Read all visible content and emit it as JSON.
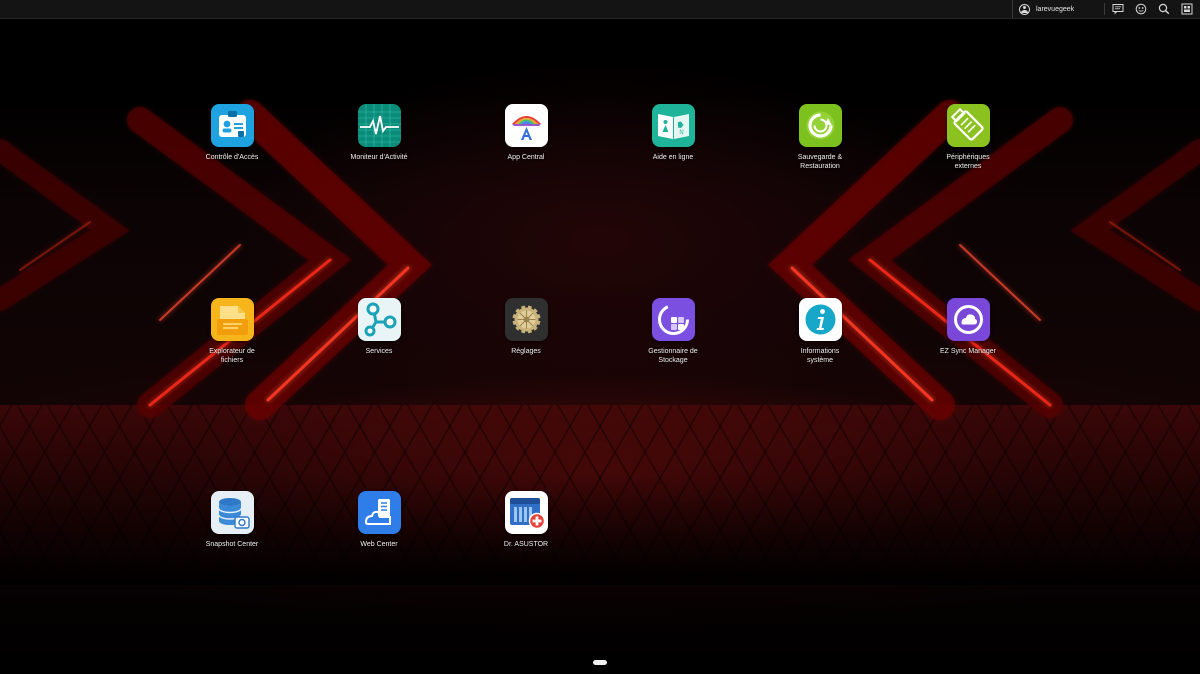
{
  "topbar": {
    "username": "larevuegeek",
    "icons": [
      "user-icon",
      "message-icon",
      "activity-icon",
      "search-icon",
      "widget-icon"
    ]
  },
  "apps": [
    {
      "label": "Contrôle d'Accès",
      "icon": "access-control-icon",
      "color": "#1fa3e0"
    },
    {
      "label": "Moniteur d'Activité",
      "icon": "activity-monitor-icon",
      "color": "#0b8c7a"
    },
    {
      "label": "App Central",
      "icon": "app-central-icon",
      "color": "#ffffff"
    },
    {
      "label": "Aide en ligne",
      "icon": "online-help-icon",
      "color": "#1fb39a"
    },
    {
      "label": "Sauvegarde &\nRestauration",
      "icon": "backup-restore-icon",
      "color": "#7cc11e"
    },
    {
      "label": "Périphériques\nexternes",
      "icon": "external-devices-icon",
      "color": "#8cc21f"
    },
    {
      "label": "Explorateur de\nfichiers",
      "icon": "file-explorer-icon",
      "color": "#f7b51c"
    },
    {
      "label": "Services",
      "icon": "services-icon",
      "color": "#e8f4f6"
    },
    {
      "label": "Réglages",
      "icon": "settings-icon",
      "color": "#2f2f2f"
    },
    {
      "label": "Gestionnaire de\nStockage",
      "icon": "storage-manager-icon",
      "color": "#7b4fe0"
    },
    {
      "label": "Informations\nsystème",
      "icon": "system-info-icon",
      "color": "#ffffff"
    },
    {
      "label": "EZ Sync Manager",
      "icon": "ez-sync-icon",
      "color": "#7a48d8"
    },
    {
      "label": "Snapshot Center",
      "icon": "snapshot-center-icon",
      "color": "#e6eef6"
    },
    {
      "label": "Web Center",
      "icon": "web-center-icon",
      "color": "#2f7de8"
    },
    {
      "label": "Dr. ASUSTOR",
      "icon": "dr-asustor-icon",
      "color": "#ffffff"
    }
  ]
}
